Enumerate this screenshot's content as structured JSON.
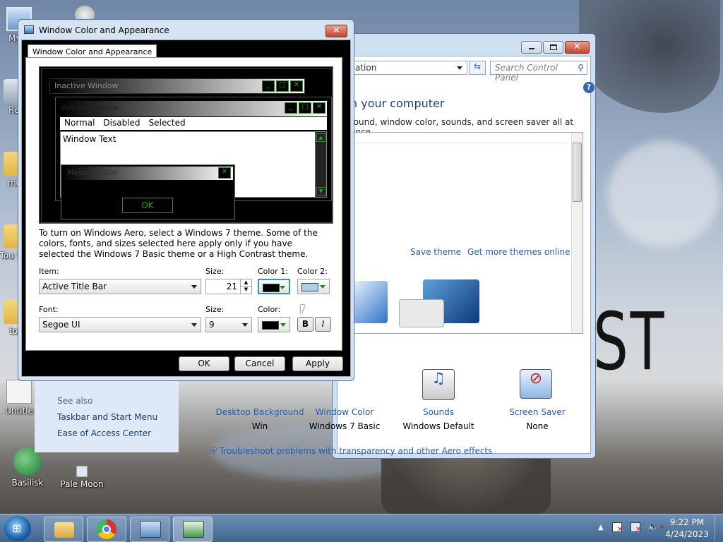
{
  "desktop": {
    "wallpaper_text": "ST",
    "icons": [
      {
        "label": "My C"
      },
      {
        "label": "Rec"
      },
      {
        "label": "mer"
      },
      {
        "label": "Tou Sub"
      },
      {
        "label": "tou"
      },
      {
        "label": "Untitle"
      },
      {
        "label": "Basilisk"
      },
      {
        "label": "Pale Moon"
      }
    ]
  },
  "control_panel": {
    "address_text": "ation",
    "search_placeholder": "Search Control Panel",
    "heading": "n your computer",
    "subtitle": "round, window color, sounds, and screen saver all at once.",
    "save_theme": "Save theme",
    "get_more": "Get more themes online",
    "bottom_items": [
      {
        "label": "Desktop Background",
        "value": "Win"
      },
      {
        "label": "Window Color",
        "value": "Windows 7 Basic"
      },
      {
        "label": "Sounds",
        "value": "Windows Default"
      },
      {
        "label": "Screen Saver",
        "value": "None"
      }
    ],
    "see_also": "See also",
    "see_also_links": [
      "Taskbar and Start Menu",
      "Ease of Access Center"
    ],
    "troubleshoot": "Troubleshoot problems with transparency and other Aero effects"
  },
  "dialog": {
    "title": "Window Color and Appearance",
    "tab": "Window Color and Appearance",
    "preview": {
      "inactive": "Inactive Window",
      "active": "Active Window",
      "menu": [
        "Normal",
        "Disabled",
        "Selected"
      ],
      "window_text": "Window Text",
      "message_box": "Message Box",
      "ok": "OK"
    },
    "info": "To turn on Windows Aero, select a Windows 7 theme.  Some of the colors, fonts, and sizes selected here apply only if you have selected the Windows 7 Basic theme or a High Contrast theme.",
    "item_label": "Item:",
    "item_value": "Active Title Bar",
    "size_label": "Size:",
    "size_value": "21",
    "color1_label": "Color 1:",
    "color2_label": "Color 2:",
    "color1": "#000000",
    "color2": "#a9d0e6",
    "font_label": "Font:",
    "font_value": "Segoe UI",
    "font_size_label": "Size:",
    "font_size_value": "9",
    "font_color_label": "Color:",
    "font_color": "#000000",
    "bold": "B",
    "italic": "I",
    "buttons": {
      "ok": "OK",
      "cancel": "Cancel",
      "apply": "Apply"
    }
  },
  "taskbar": {
    "time": "9:22 PM",
    "date": "4/24/2023"
  }
}
